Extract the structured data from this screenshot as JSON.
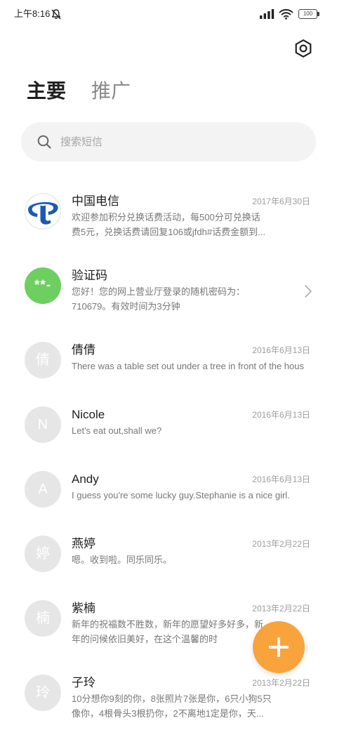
{
  "status_bar": {
    "time": "上午8:16",
    "battery_level": "100",
    "icons": {
      "notifications": "mute-notification-icon",
      "signal": "signal-icon",
      "wifi": "wifi-icon",
      "battery": "battery-icon"
    }
  },
  "header": {
    "settings_icon": "settings-icon"
  },
  "tabs": [
    {
      "label": "主要",
      "active": true
    },
    {
      "label": "推广",
      "active": false
    }
  ],
  "search": {
    "icon": "search-icon",
    "placeholder": "搜索短信",
    "value": ""
  },
  "conversations": [
    {
      "name": "中国电信",
      "date": "2017年6月30日",
      "avatar_icon": "china-telecom-logo",
      "avatar_icon_color": "#1b5ab3",
      "message_lines": [
        "欢迎参加积分兑换话费活动，每500分可兑换话",
        "费5元，兑换话费请回复106或jfdh#话费金额到..."
      ]
    },
    {
      "name": "验证码",
      "avatar_text": "**-",
      "avatar_color": "#6ccf5f",
      "action_icon": "chevron-right-icon",
      "message_lines": [
        "您好！您的网上营业厅登录的随机密码为：",
        "710679。有效时间为3分钟"
      ]
    },
    {
      "name": "倩倩",
      "date": "2016年6月13日",
      "avatar_text": "倩",
      "message_lines": [
        "There was a table set out under a tree in front of the hous"
      ]
    },
    {
      "name": "Nicole",
      "date": "2016年6月13日",
      "avatar_text": "N",
      "message_lines": [
        "Let's eat out,shall we?"
      ]
    },
    {
      "name": "Andy",
      "date": "2016年6月13日",
      "avatar_text": "A",
      "message_lines": [
        "I guess you're some lucky guy.Stephanie is a nice girl."
      ]
    },
    {
      "name": "燕婷",
      "date": "2013年2月22日",
      "avatar_text": "婷",
      "message_lines": [
        "嗯。收到啦。同乐同乐。"
      ]
    },
    {
      "name": "紫楠",
      "date": "2013年2月22日",
      "avatar_text": "楠",
      "message_lines": [
        "新年的祝福数不胜数，新年的愿望好多好多，新",
        "年的问候依旧美好，在这个温馨的时"
      ]
    },
    {
      "name": "子玲",
      "date": "2013年2月22日",
      "avatar_text": "玲",
      "message_lines": [
        "10分想你9刻的你，8张照片7张是你，6只小狗5只",
        "像你，4根骨头3根扔你，2不离地1定是你，天..."
      ]
    }
  ],
  "compose_button": {
    "icon": "plus-icon",
    "color": "#f9a33c"
  },
  "colors": {
    "avatar_placeholder": "#e6e6e6",
    "search_background": "#f3f3f3"
  }
}
